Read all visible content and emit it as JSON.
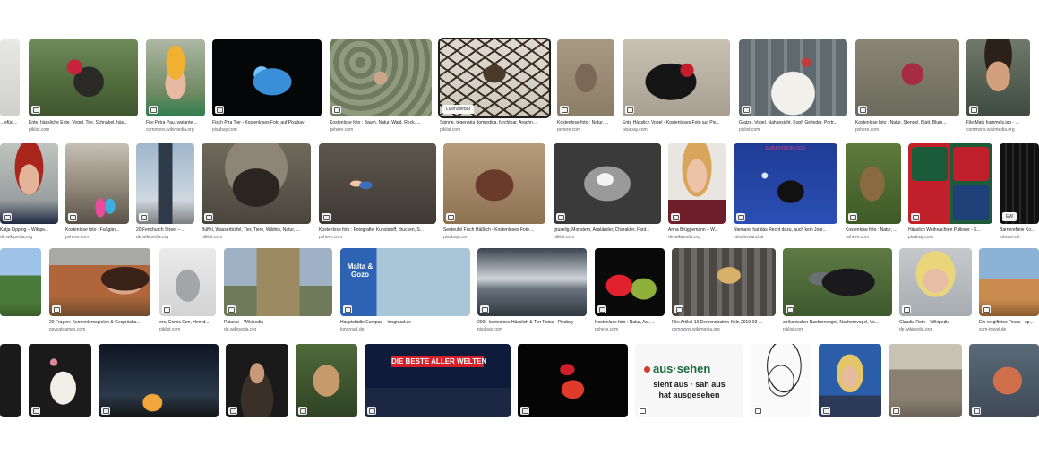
{
  "results": {
    "row1": [
      {
        "title": "…efügel…",
        "source": "",
        "label": "bird thumbnail"
      },
      {
        "title": "Ente, hässliche Ente, Vogel, Tier, Schnabel, häs...",
        "source": "piklist.com",
        "label": "Muscovy duck"
      },
      {
        "title": "File:Petra Pau, variante ...",
        "source": "commons.wikimedia.org",
        "label": "portrait of woman with red hair"
      },
      {
        "title": "Fisch Pira Tier - Kostenloses Foto auf Pixabay",
        "source": "pixabay.com",
        "label": "blue fish"
      },
      {
        "title": "Kostenlose foto : Baum, Natur, Wald, Rock, ...",
        "source": "pxhere.com",
        "label": "pumpkin skin"
      },
      {
        "title": "Spinne, tegenaria domestica, furchtbar, Arachn...",
        "source": "piklist.com",
        "label": "house spider",
        "license_label": "Lizenzierbar"
      },
      {
        "title": "Kostenlose foto : Natur, ...",
        "source": "pxhere.com",
        "label": "warthog"
      },
      {
        "title": "Ente Hässlich Vogel - Kostenloses Foto auf Pix...",
        "source": "pixabay.com",
        "label": "Muscovy duck profile"
      },
      {
        "title": "Glatze, Vogel, Nahansicht, Kopf, Gefieder, Portr...",
        "source": "piklist.com",
        "label": "white turkey"
      },
      {
        "title": "Kostenlose foto : Natur, Stengel, Blatt, Blum...",
        "source": "pxhere.com",
        "label": "red flower bud"
      },
      {
        "title": "File:Mats hummels.jpg - ...",
        "source": "commons.wikimedia.org",
        "label": "smiling man"
      }
    ],
    "row2": [
      {
        "title": "Katja Kipping – Wikipe...",
        "source": "de.wikipedia.org",
        "label": "woman portrait"
      },
      {
        "title": "Kostenlose foto : Fußgän...",
        "source": "pxhere.com",
        "label": "street with umbrellas"
      },
      {
        "title": "20 Fenchurch Street – ...",
        "source": "de.wikipedia.org",
        "label": "skyscraper"
      },
      {
        "title": "Büffel, Wasserbüffel, Tier, Tiere, Wildnis, Natur, ...",
        "source": "piklist.com",
        "label": "buffalo"
      },
      {
        "title": "Kostenlose foto : Fotografie, Kunststoff, drucken, S...",
        "source": "pxhere.com",
        "label": "doll in dirt"
      },
      {
        "title": "Seeteufel Fisch Häßlich - Kostenloses Foto ...",
        "source": "pixabay.com",
        "label": "monkfish"
      },
      {
        "title": "gruselig, Monstern, Ausländer, Charakter, Fant...",
        "source": "piklist.com",
        "label": "stone face"
      },
      {
        "title": "Anna Brüggemann – W...",
        "source": "de.wikipedia.org",
        "label": "blonde woman"
      },
      {
        "title": "Niemand hat das Recht dazu, auch kein Jour...",
        "source": "missfinnland.at",
        "label": "eurovision stage",
        "overlay": "EUROVISION 2019"
      },
      {
        "title": "Kostenlose foto : Natur, ...",
        "source": "pxhere.com",
        "label": "wooden mask"
      },
      {
        "title": "Hässlich Weihnachten Pullover - K...",
        "source": "pixabay.com",
        "label": "christmas sweaters"
      },
      {
        "title": "Barrierefreie Komm...",
        "source": "tolwani.de",
        "label": "dark pictograms",
        "overlay": "EW"
      }
    ],
    "row3": [
      {
        "title": "",
        "source": "",
        "label": "landscape"
      },
      {
        "title": "20 Fragen: Kennenlernspielen & Gesprächs...",
        "source": "psycatgames.com",
        "label": "woman laughing"
      },
      {
        "title": "orc, Comic Con, Herr d...",
        "source": "piklist.com",
        "label": "armored figure"
      },
      {
        "title": "Patuxai – Wikipedia",
        "source": "de.wikipedia.org",
        "label": "Patuxai monument"
      },
      {
        "title": "Hauptstädte Europas – longroad.de",
        "source": "longroad.de",
        "label": "Malta sign",
        "overlay": "Malta & Gozo"
      },
      {
        "title": "200+ kostenlose Hässlich & Tier Fotos - Pixabay",
        "source": "pixabay.com",
        "label": "mountain clouds"
      },
      {
        "title": "Kostenlose foto : Natur, Ast, ...",
        "source": "pxhere.com",
        "label": "red flower"
      },
      {
        "title": "File:Artikel 13 Demonstration Köln 2019-03-...",
        "source": "commons.wikimedia.org",
        "label": "demonstration"
      },
      {
        "title": "afrikanischer Nashornvogel, Nashornvogel, Vo...",
        "source": "piklist.com",
        "label": "hornbill"
      },
      {
        "title": "Claudia Roth – Wikipedia",
        "source": "de.wikipedia.org",
        "label": "blonde woman smiling"
      },
      {
        "title": "Ein vergiftetes Finale - sp...",
        "source": "sgm-travel.de",
        "label": "coastal landscape"
      }
    ],
    "row4": [
      {
        "title": "",
        "source": "",
        "label": "dark image"
      },
      {
        "title": "",
        "source": "",
        "label": "white swan"
      },
      {
        "title": "",
        "source": "",
        "label": "starry night landscape"
      },
      {
        "title": "",
        "source": "",
        "label": "person dark"
      },
      {
        "title": "",
        "source": "",
        "label": "bulldog"
      },
      {
        "title": "",
        "source": "",
        "label": "cinema premiere",
        "overlay": "DIE BESTE ALLER WELTEN"
      },
      {
        "title": "",
        "source": "",
        "label": "red light"
      },
      {
        "title": "",
        "source": "",
        "label": "aussehen conjugation",
        "word": "aus·sehen",
        "line1": "sieht aus · sah aus",
        "line2": "hat ausgesehen"
      },
      {
        "title": "",
        "source": "",
        "label": "sketch of face"
      },
      {
        "title": "",
        "source": "",
        "label": "news anchor"
      },
      {
        "title": "",
        "source": "",
        "label": "old street"
      },
      {
        "title": "",
        "source": "",
        "label": "red fish"
      }
    ]
  },
  "colors": {
    "caption": "#202124",
    "source": "#5f6368",
    "border": "#1f1f1f"
  }
}
